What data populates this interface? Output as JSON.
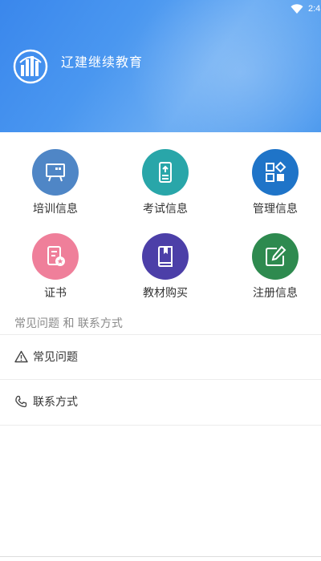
{
  "status_bar": {
    "time": "2:4",
    "wifi_icon": "wifi-icon"
  },
  "header": {
    "title": "辽建继续教育",
    "logo_icon": "building-logo-icon",
    "gradient_colors": [
      "#3a87ec",
      "#6aacf3"
    ]
  },
  "menu": [
    {
      "label": "培训信息",
      "icon": "presentation-board-icon",
      "color": "#4f86c6"
    },
    {
      "label": "考试信息",
      "icon": "exam-document-icon",
      "color": "#29a6a9"
    },
    {
      "label": "管理信息",
      "icon": "management-grid-icon",
      "color": "#1f74c8"
    },
    {
      "label": "证书",
      "icon": "certificate-icon",
      "color": "#ef7f9a"
    },
    {
      "label": "教材购买",
      "icon": "textbook-icon",
      "color": "#4c3fa8"
    },
    {
      "label": "注册信息",
      "icon": "register-edit-icon",
      "color": "#2e8a4f"
    }
  ],
  "section": {
    "title": "常见问题 和 联系方式"
  },
  "list": [
    {
      "label": "常见问题",
      "icon": "warning-triangle-icon"
    },
    {
      "label": "联系方式",
      "icon": "phone-icon"
    }
  ]
}
